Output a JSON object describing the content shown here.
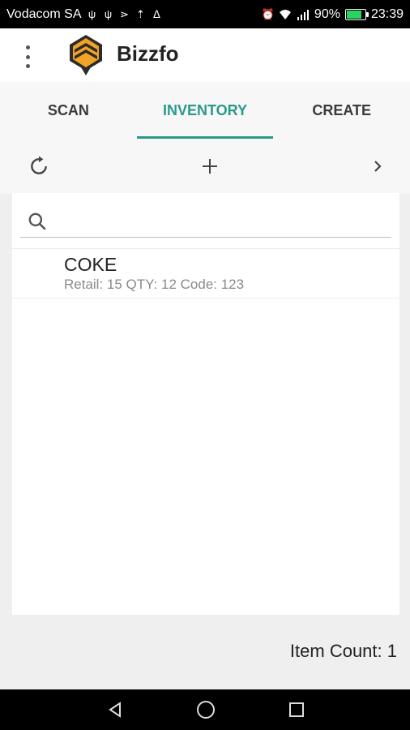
{
  "status_bar": {
    "carrier": "Vodacom SA",
    "battery_percent": "90%",
    "time": "23:39",
    "icons": [
      "usb-icon",
      "usb-icon",
      "signal-boost-icon",
      "upload-icon",
      "flame-icon",
      "alarm-icon",
      "wifi-icon",
      "cell-signal-icon",
      "battery-icon"
    ]
  },
  "app_bar": {
    "title": "Bizzfo",
    "menu_icon": "more-vert-icon",
    "logo": "bizzfo-logo"
  },
  "tabs": [
    {
      "label": "SCAN",
      "active": false
    },
    {
      "label": "INVENTORY",
      "active": true
    },
    {
      "label": "CREATE",
      "active": false
    }
  ],
  "toolbar": {
    "refresh_icon": "refresh-icon",
    "add_icon": "plus-icon",
    "next_icon": "chevron-right-icon"
  },
  "search": {
    "value": "",
    "placeholder": ""
  },
  "inventory_items": [
    {
      "name": "COKE",
      "details": "Retail: 15 QTY: 12 Code: 123"
    }
  ],
  "footer": {
    "item_count_label": "Item Count: 1"
  },
  "colors": {
    "accent": "#2a9a88",
    "logo_orange": "#f2a226",
    "logo_dark": "#2b2b2b"
  },
  "nav_bar": {
    "icons": [
      "back-icon",
      "home-icon",
      "recents-icon"
    ]
  }
}
